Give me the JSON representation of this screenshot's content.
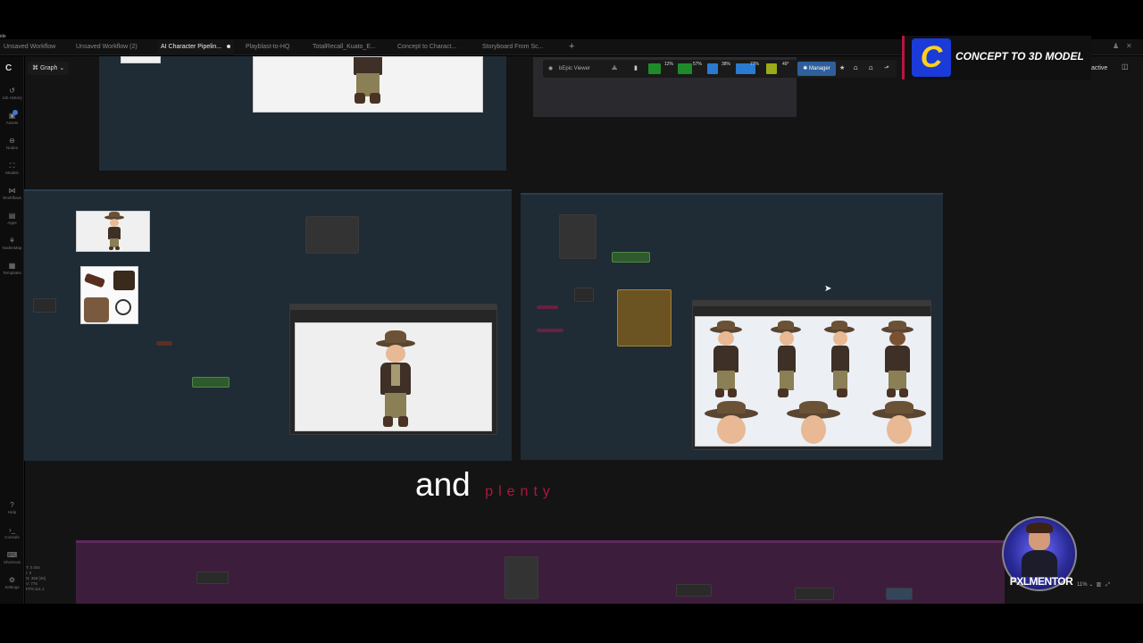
{
  "app": {
    "corner_label": "ide"
  },
  "tabs": [
    {
      "label": "Unsaved Workflow",
      "active": false
    },
    {
      "label": "Unsaved Workflow (2)",
      "active": false
    },
    {
      "label": "AI Character Pipelin...",
      "active": true
    },
    {
      "label": "Playblast-to-HQ",
      "active": false
    },
    {
      "label": "TotalRecall_Kuato_E...",
      "active": false
    },
    {
      "label": "Concept to Charact...",
      "active": false
    },
    {
      "label": "Storyboard From Sc...",
      "active": false
    }
  ],
  "sidebar": {
    "items": [
      {
        "icon": "history-icon",
        "label": "Job History"
      },
      {
        "icon": "assets-icon",
        "label": "Assets"
      },
      {
        "icon": "nodes-icon",
        "label": "Nodes"
      },
      {
        "icon": "models-icon",
        "label": "Models"
      },
      {
        "icon": "workflows-icon",
        "label": "Workflows"
      },
      {
        "icon": "apps-icon",
        "label": "Apps"
      },
      {
        "icon": "nodesmap-icon",
        "label": "NodesMap"
      },
      {
        "icon": "templates-icon",
        "label": "Templates"
      }
    ],
    "bottom_items": [
      {
        "icon": "help-icon",
        "label": "Help"
      },
      {
        "icon": "console-icon",
        "label": "Console"
      },
      {
        "icon": "shortcuts-icon",
        "label": "Shortcuts"
      },
      {
        "icon": "settings-icon",
        "label": "Settings"
      }
    ],
    "stats": [
      "T: 0.00s",
      "I: 0",
      "N: 368 [36]",
      "V: 776",
      "FPS:111.1"
    ]
  },
  "toolbar": {
    "graph_label": "Graph",
    "interactive_label": "active"
  },
  "monitor": {
    "viewer_label": "bEpic Viewer",
    "cpu": {
      "label": "CPU",
      "value": "12%"
    },
    "ram": {
      "label": "RAM",
      "value": "57%"
    },
    "gpu": {
      "label": "GPU",
      "value": "38%"
    },
    "vram": {
      "label": "VRAM",
      "value": "77%"
    },
    "temp": {
      "label": "Temp",
      "value": "49°"
    },
    "manager_label": "Manager"
  },
  "brand": {
    "logo_letter": "C",
    "title": "CONCEPT TO 3D MODEL"
  },
  "caption": {
    "word1": "and",
    "word2": "plenty"
  },
  "mentor": {
    "label_prefix": "PXL",
    "label_suffix": "MENTOR"
  },
  "zoom": {
    "value": "11%"
  },
  "colors": {
    "accent_red": "#b0163f",
    "brand_blue": "#1b3bd8",
    "brand_yellow": "#ffd21a",
    "group_bg": "#1f2b35",
    "purple_group": "#3c1e3c"
  }
}
